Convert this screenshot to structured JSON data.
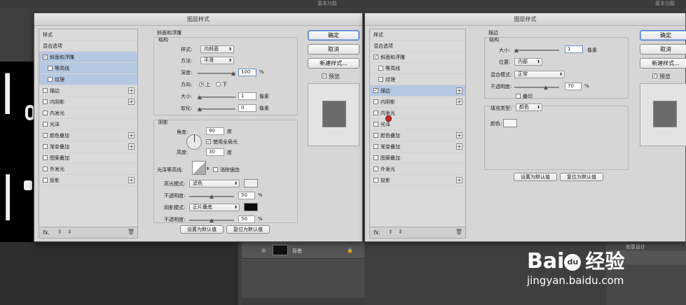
{
  "topbar": {
    "workspace_label": "基本功能"
  },
  "left_dialog": {
    "title": "图层样式",
    "styles_list": [
      {
        "label": "样式",
        "checkbox": false,
        "plus": false,
        "selected": false
      },
      {
        "label": "混合选项",
        "checkbox": false,
        "plus": false,
        "selected": false
      },
      {
        "label": "斜面和浮雕",
        "checkbox": true,
        "checked": true,
        "plus": false,
        "selected": true
      },
      {
        "label": "等高线",
        "checkbox": true,
        "checked": false,
        "plus": false,
        "selected": true,
        "sub": true
      },
      {
        "label": "纹理",
        "checkbox": true,
        "checked": false,
        "plus": false,
        "selected": true,
        "sub": true
      },
      {
        "label": "描边",
        "checkbox": true,
        "checked": false,
        "plus": true,
        "selected": false
      },
      {
        "label": "内阴影",
        "checkbox": true,
        "checked": false,
        "plus": true,
        "selected": false
      },
      {
        "label": "内发光",
        "checkbox": true,
        "checked": false,
        "plus": false,
        "selected": false
      },
      {
        "label": "光泽",
        "checkbox": true,
        "checked": false,
        "plus": false,
        "selected": false
      },
      {
        "label": "颜色叠加",
        "checkbox": true,
        "checked": false,
        "plus": true,
        "selected": false
      },
      {
        "label": "渐变叠加",
        "checkbox": true,
        "checked": false,
        "plus": true,
        "selected": false
      },
      {
        "label": "图案叠加",
        "checkbox": true,
        "checked": false,
        "plus": false,
        "selected": false
      },
      {
        "label": "外发光",
        "checkbox": true,
        "checked": false,
        "plus": false,
        "selected": false
      },
      {
        "label": "投影",
        "checkbox": true,
        "checked": false,
        "plus": true,
        "selected": false
      }
    ],
    "footer_fx": "fx.",
    "bevel": {
      "heading": "斜面和浮雕",
      "structure_heading": "结构",
      "style_label": "样式:",
      "style_value": "内斜面",
      "technique_label": "方法:",
      "technique_value": "平滑",
      "depth_label": "深度:",
      "depth_value": "100",
      "depth_unit": "%",
      "direction_label": "方向:",
      "dir_up": "上",
      "dir_down": "下",
      "size_label": "大小:",
      "size_value": "1",
      "size_unit": "像素",
      "soften_label": "软化:",
      "soften_value": "0",
      "soften_unit": "像素"
    },
    "shading": {
      "heading": "阴影",
      "angle_label": "角度:",
      "angle_value": "90",
      "angle_unit": "度",
      "global_light_label": "使用全局光",
      "altitude_label": "高度:",
      "altitude_value": "30",
      "altitude_unit": "度",
      "gloss_contour_label": "光泽等高线:",
      "anti_alias_label": "消除锯齿",
      "highlight_mode_label": "高光模式:",
      "highlight_mode_value": "滤色",
      "highlight_opacity_label": "不透明度:",
      "highlight_opacity_value": "50",
      "highlight_opacity_unit": "%",
      "shadow_mode_label": "阴影模式:",
      "shadow_mode_value": "正片叠底",
      "shadow_opacity_label": "不透明度:",
      "shadow_opacity_value": "50",
      "shadow_opacity_unit": "%"
    },
    "make_default": "设置为默认值",
    "reset_default": "复位为默认值",
    "ok": "确定",
    "cancel": "取消",
    "new_style": "新建样式...",
    "preview": "预览"
  },
  "right_dialog": {
    "title": "图层样式",
    "styles_list": [
      {
        "label": "样式",
        "checkbox": false,
        "plus": false,
        "selected": false
      },
      {
        "label": "混合选项",
        "checkbox": false,
        "plus": false,
        "selected": false
      },
      {
        "label": "斜面和浮雕",
        "checkbox": true,
        "checked": true,
        "plus": false,
        "selected": false
      },
      {
        "label": "等高线",
        "checkbox": true,
        "checked": false,
        "plus": false,
        "selected": false,
        "sub": true
      },
      {
        "label": "纹理",
        "checkbox": true,
        "checked": false,
        "plus": false,
        "selected": false,
        "sub": true
      },
      {
        "label": "描边",
        "checkbox": true,
        "checked": true,
        "plus": true,
        "selected": true
      },
      {
        "label": "内阴影",
        "checkbox": true,
        "checked": false,
        "plus": true,
        "selected": false
      },
      {
        "label": "内发光",
        "checkbox": true,
        "checked": false,
        "plus": false,
        "selected": false
      },
      {
        "label": "光泽",
        "checkbox": true,
        "checked": false,
        "plus": false,
        "selected": false
      },
      {
        "label": "颜色叠加",
        "checkbox": true,
        "checked": false,
        "plus": true,
        "selected": false
      },
      {
        "label": "渐变叠加",
        "checkbox": true,
        "checked": false,
        "plus": true,
        "selected": false
      },
      {
        "label": "图案叠加",
        "checkbox": true,
        "checked": false,
        "plus": false,
        "selected": false
      },
      {
        "label": "外发光",
        "checkbox": true,
        "checked": false,
        "plus": false,
        "selected": false
      },
      {
        "label": "投影",
        "checkbox": true,
        "checked": false,
        "plus": true,
        "selected": false
      }
    ],
    "footer_fx": "fx.",
    "stroke": {
      "heading": "描边",
      "structure_heading": "结构",
      "size_label": "大小:",
      "size_value": "1",
      "size_unit": "像素",
      "position_label": "位置:",
      "position_value": "内部",
      "blend_label": "混合模式:",
      "blend_value": "正常",
      "opacity_label": "不透明度:",
      "opacity_value": "70",
      "opacity_unit": "%",
      "overprint_label": "叠印",
      "fill_type_label": "填充类型:",
      "fill_type_value": "颜色",
      "color_label": "颜色:"
    },
    "make_default": "设置为默认值",
    "reset_default": "复位为默认值",
    "ok": "确定",
    "cancel": "取消",
    "new_style": "新建样式...",
    "preview": "预览"
  },
  "layers": {
    "background_layer": "背景",
    "panel_tab": "创意设计"
  },
  "watermark": {
    "brand": "Bai",
    "paw": "du",
    "cn": "经验",
    "url": "jingyan.baidu.com"
  },
  "colors": {
    "dialog_bg": "#d6d6d6",
    "selection": "#b5c8e2",
    "preview_swatch": "#6b6b6b"
  }
}
